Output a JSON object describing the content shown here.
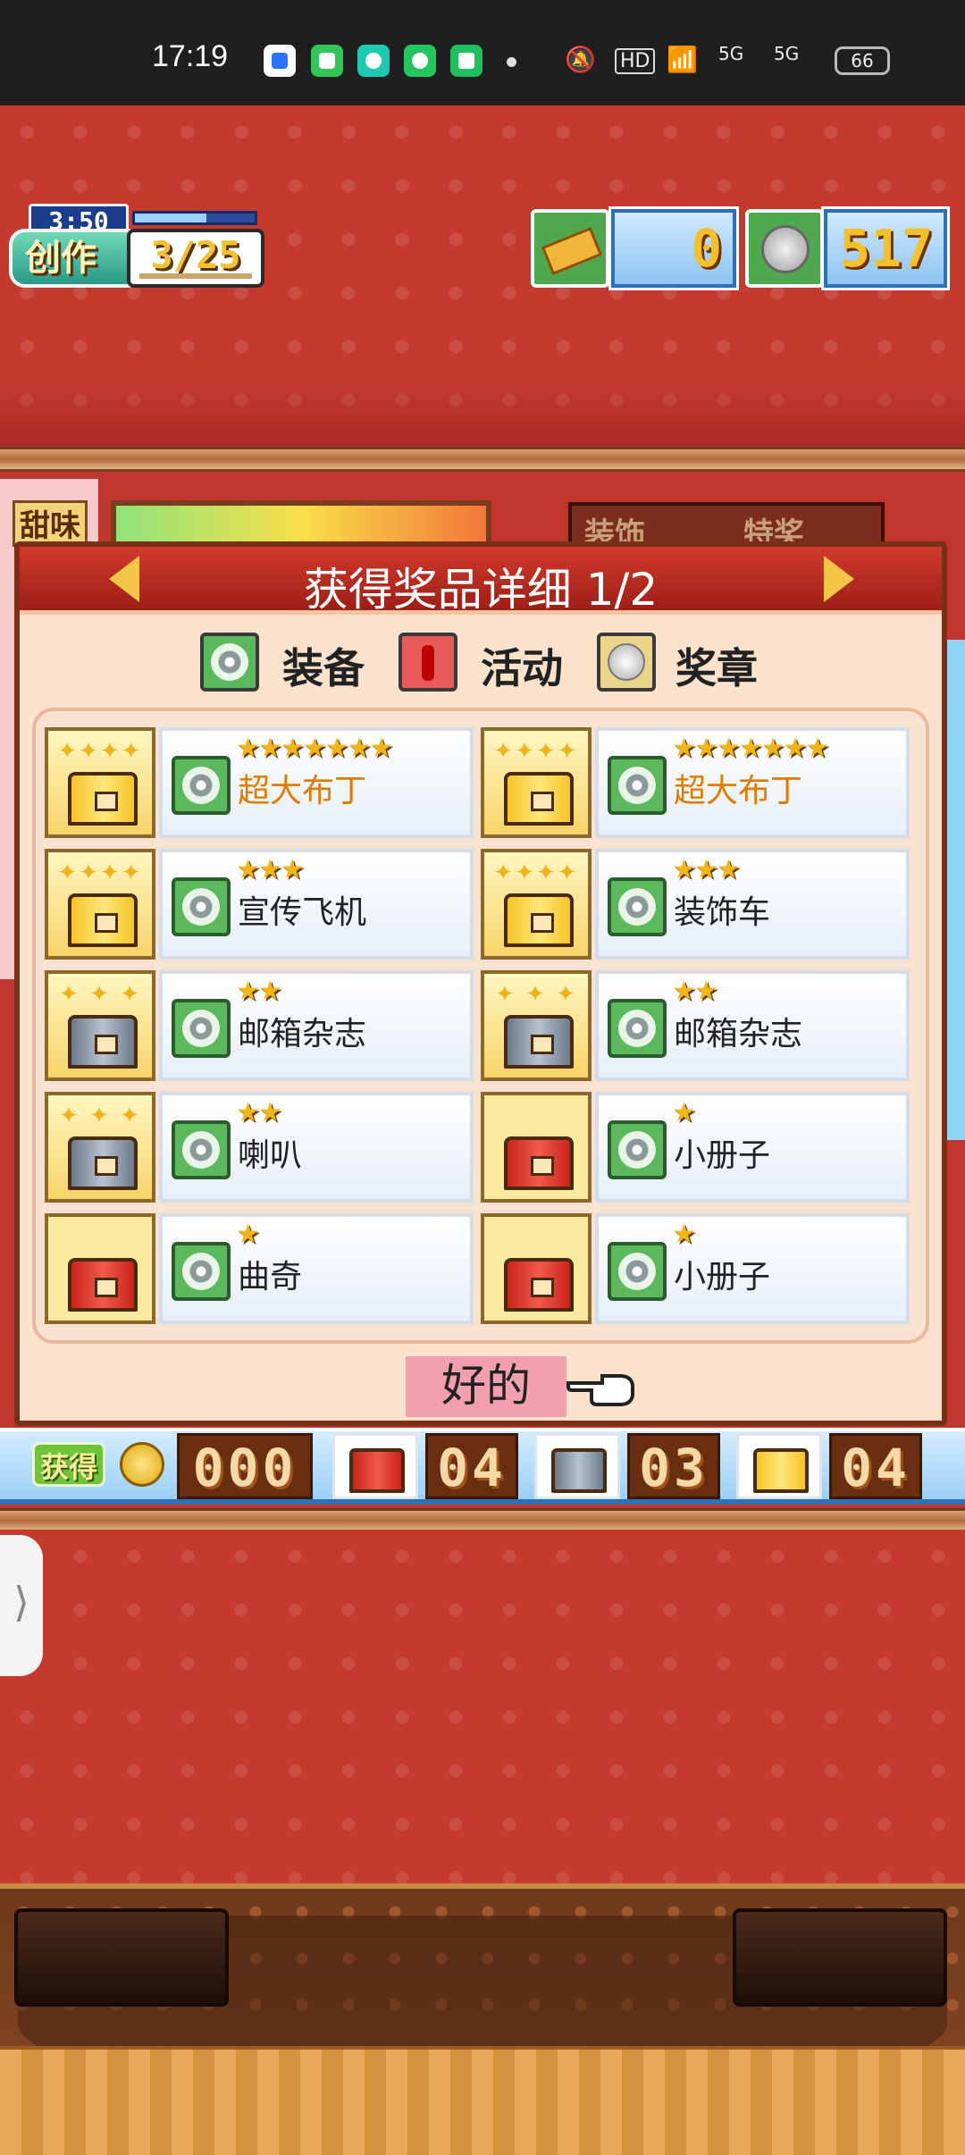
{
  "status_bar": {
    "time": "17:19",
    "hd_label": "HD",
    "network_1": "5G",
    "network_2": "5G",
    "battery": "66"
  },
  "hud": {
    "timer": "3:50",
    "create_label": "创作",
    "create_count": "3/25",
    "timer_fill_fraction": 0.6,
    "ticket_count": "0",
    "coin_count": "517"
  },
  "background": {
    "sweet_label": "甜味",
    "tab_labels": [
      "装饰",
      "特奖"
    ]
  },
  "popup": {
    "title": "获得奖品详细 1/2",
    "legend": {
      "equip": "装备",
      "event": "活动",
      "prize": "奖章"
    },
    "items": [
      {
        "name": "超大布丁",
        "stars": "★★★★★★★",
        "chest": "gold",
        "highlight": true
      },
      {
        "name": "超大布丁",
        "stars": "★★★★★★★",
        "chest": "gold",
        "highlight": true
      },
      {
        "name": "宣传飞机",
        "stars": "★★★",
        "chest": "gold",
        "highlight": false
      },
      {
        "name": "装饰车",
        "stars": "★★★",
        "chest": "gold",
        "highlight": false
      },
      {
        "name": "邮箱杂志",
        "stars": "★★",
        "chest": "silver",
        "highlight": false
      },
      {
        "name": "邮箱杂志",
        "stars": "★★",
        "chest": "silver",
        "highlight": false
      },
      {
        "name": "喇叭",
        "stars": "★★",
        "chest": "silver",
        "highlight": false
      },
      {
        "name": "小册子",
        "stars": "★",
        "chest": "red",
        "highlight": false
      },
      {
        "name": "曲奇",
        "stars": "★",
        "chest": "red",
        "highlight": false
      },
      {
        "name": "小册子",
        "stars": "★",
        "chest": "red",
        "highlight": false
      }
    ],
    "ok_label": "好的"
  },
  "counter_bar": {
    "get_label": "获得",
    "coin_total": "000",
    "red_count": "04",
    "silver_count": "03",
    "gold_count": "04"
  },
  "drawer_handle": "⟩",
  "colors": {
    "background_red": "#c53a2f",
    "popup_bg": "#fbe2cd",
    "header_red": "#b52a1f",
    "highlight_orange": "#e07b00",
    "star_gold": "#f2b516"
  }
}
